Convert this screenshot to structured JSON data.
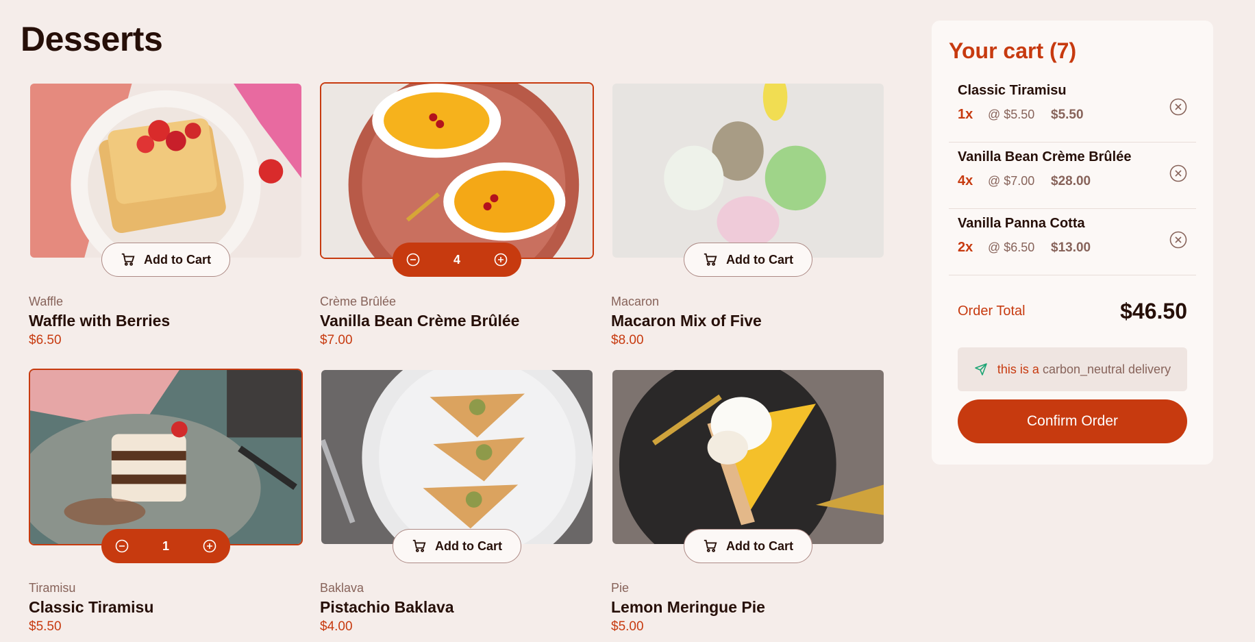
{
  "page": {
    "title": "Desserts"
  },
  "add_label": "Add to Cart",
  "products": [
    {
      "category": "Waffle",
      "name": "Waffle with Berries",
      "price": "$6.50",
      "in_cart": false,
      "quantity": ""
    },
    {
      "category": "Crème Brûlée",
      "name": "Vanilla Bean Crème Brûlée",
      "price": "$7.00",
      "in_cart": true,
      "quantity": "4"
    },
    {
      "category": "Macaron",
      "name": "Macaron Mix of Five",
      "price": "$8.00",
      "in_cart": false,
      "quantity": ""
    },
    {
      "category": "Tiramisu",
      "name": "Classic Tiramisu",
      "price": "$5.50",
      "in_cart": true,
      "quantity": "1"
    },
    {
      "category": "Baklava",
      "name": "Pistachio Baklava",
      "price": "$4.00",
      "in_cart": false,
      "quantity": ""
    },
    {
      "category": "Pie",
      "name": "Lemon Meringue Pie",
      "price": "$5.00",
      "in_cart": false,
      "quantity": ""
    }
  ],
  "cart": {
    "title": "Your cart (7)",
    "items": [
      {
        "name": "Classic Tiramisu",
        "qty": "1x",
        "unit": "@ $5.50",
        "total": "$5.50"
      },
      {
        "name": "Vanilla Bean Crème Brûlée",
        "qty": "4x",
        "unit": "@ $7.00",
        "total": "$28.00"
      },
      {
        "name": "Vanilla Panna Cotta",
        "qty": "2x",
        "unit": "@ $6.50",
        "total": "$13.00"
      }
    ],
    "order_total_label": "Order Total",
    "order_total_value": "$46.50",
    "carbon_lead": "this is a",
    "carbon_rest": "carbon_neutral delivery",
    "confirm_label": "Confirm Order"
  },
  "colors": {
    "accent": "#c73a0f",
    "background": "#f5edea",
    "text": "#260f08",
    "muted": "#87635a"
  }
}
